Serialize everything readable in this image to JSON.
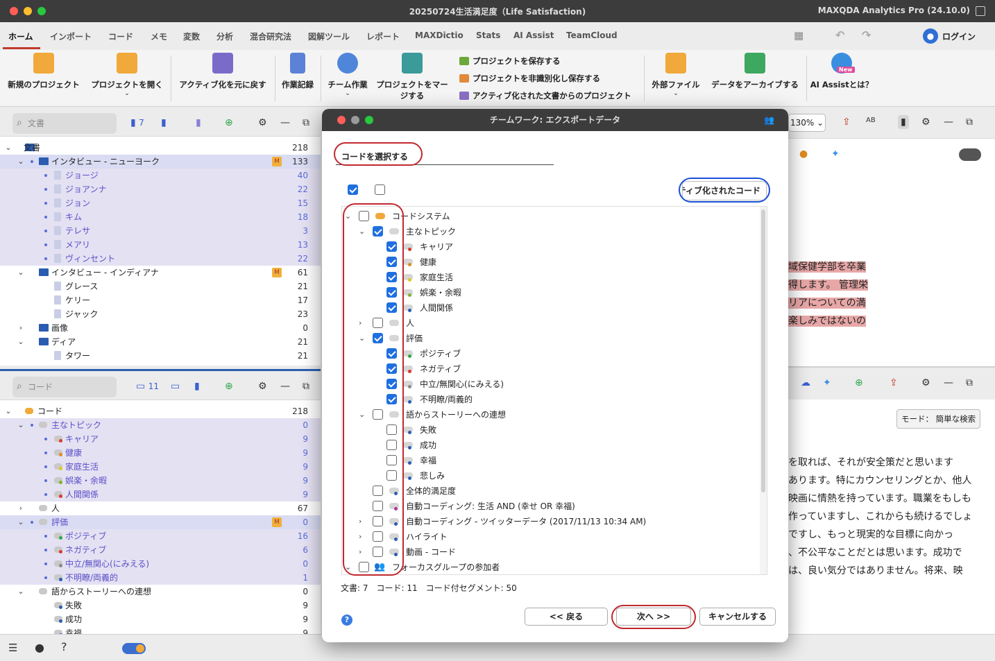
{
  "window": {
    "title": "20250724生活満足度（Life Satisfaction)",
    "app": "MAXQDA Analytics Pro (24.10.0)"
  },
  "menu": {
    "tabs": [
      "ホーム",
      "インポート",
      "コード",
      "メモ",
      "変数",
      "分析",
      "混合研究法",
      "図解ツール",
      "レポート",
      "MAXDictio",
      "Stats",
      "AI Assist",
      "TeamCloud"
    ],
    "login": "ログイン"
  },
  "ribbon": {
    "new_project": "新規のプロジェクト",
    "open_project": "プロジェクトを開く",
    "undo_activation": "アクティブ化を元に戻す",
    "log": "作業記録",
    "teamwork": "チーム作業",
    "merge": "プロジェクトをマージする",
    "save_project": "プロジェクトを保存する",
    "save_anon": "プロジェクトを非識別化し保存する",
    "from_active": "アクティブ化された文書からのプロジェクト",
    "external": "外部ファイル",
    "archive": "データをアーカイブする",
    "ai_assist": "AI Assistとは？",
    "new_badge": "New"
  },
  "doc_panel": {
    "search_placeholder": "文書",
    "count": "7",
    "rows": [
      {
        "label": "文書",
        "num": "218"
      },
      {
        "label": "インタビュー - ニューヨーク",
        "num": "133",
        "badge": "M"
      },
      {
        "label": "ジョージ",
        "num": "40"
      },
      {
        "label": "ジョアンナ",
        "num": "22"
      },
      {
        "label": "ジョン",
        "num": "15"
      },
      {
        "label": "キム",
        "num": "18"
      },
      {
        "label": "テレサ",
        "num": "3"
      },
      {
        "label": "メアリ",
        "num": "13"
      },
      {
        "label": "ヴィンセント",
        "num": "22"
      },
      {
        "label": "インタビュー - インディアナ",
        "num": "61",
        "badge": "M"
      },
      {
        "label": "グレース",
        "num": "21"
      },
      {
        "label": "ケリー",
        "num": "17"
      },
      {
        "label": "ジャック",
        "num": "23"
      },
      {
        "label": "画像",
        "num": "0"
      },
      {
        "label": "ディア",
        "num": "21"
      },
      {
        "label": "タワー",
        "num": "21"
      }
    ]
  },
  "code_panel": {
    "search_placeholder": "コード",
    "count": "11",
    "rows": [
      {
        "label": "コード",
        "num": "218"
      },
      {
        "label": "主なトピック",
        "num": "0"
      },
      {
        "label": "キャリア",
        "num": "9"
      },
      {
        "label": "健康",
        "num": "9"
      },
      {
        "label": "家庭生活",
        "num": "9"
      },
      {
        "label": "娯楽・余暇",
        "num": "9"
      },
      {
        "label": "人間関係",
        "num": "9"
      },
      {
        "label": "人",
        "num": "67"
      },
      {
        "label": "評価",
        "num": "0",
        "badge": "M"
      },
      {
        "label": "ポジティブ",
        "num": "16"
      },
      {
        "label": "ネガティブ",
        "num": "6"
      },
      {
        "label": "中立/無関心(にみえる)",
        "num": "0"
      },
      {
        "label": "不明瞭/両義的",
        "num": "1"
      },
      {
        "label": "語からストーリーへの連想",
        "num": "0"
      },
      {
        "label": "失敗",
        "num": "9"
      },
      {
        "label": "成功",
        "num": "9"
      },
      {
        "label": "幸福",
        "num": "9"
      }
    ]
  },
  "right_panel": {
    "zoom": "130%",
    "upper_text": [
      "域保健学部を卒業",
      "得します。 管理栄",
      "リアについての満",
      "楽しみではないの"
    ],
    "mode_label": "モード： 簡単な検索",
    "lower_text": [
      "を取れば、それが安全策だと思います",
      "あります。特にカウンセリングとか、他人",
      "映画に情熱を持っています。職業をもしも",
      "作っていますし、これからも続けるでしょ",
      "ですし、もっと現実的な目標に向かっ",
      "、不公平なことだとは思います。成功で",
      "は、良い気分ではありません。将来、映"
    ]
  },
  "dialog": {
    "title": "チームワーク: エクスポートデータ",
    "tab": "コードを選択する",
    "active_button": "アクティブ化されたコード",
    "tree": [
      {
        "label": "コードシステム",
        "checked": false,
        "depth": 0,
        "chev": "v"
      },
      {
        "label": "主なトピック",
        "checked": true,
        "depth": 1,
        "chev": "v"
      },
      {
        "label": "キャリア",
        "checked": true,
        "depth": 2,
        "color": "#d93a2b"
      },
      {
        "label": "健康",
        "checked": true,
        "depth": 2,
        "color": "#e08a1e"
      },
      {
        "label": "家庭生活",
        "checked": true,
        "depth": 2,
        "color": "#e0c81e"
      },
      {
        "label": "娯楽・余暇",
        "checked": true,
        "depth": 2,
        "color": "#7bb52a"
      },
      {
        "label": "人間関係",
        "checked": true,
        "depth": 2,
        "color": "#2a5db0"
      },
      {
        "label": "人",
        "checked": false,
        "depth": 1,
        "chev": ">"
      },
      {
        "label": "評価",
        "checked": true,
        "depth": 1,
        "chev": "v"
      },
      {
        "label": "ポジティブ",
        "checked": true,
        "depth": 2,
        "color": "#2fa84a"
      },
      {
        "label": "ネガティブ",
        "checked": true,
        "depth": 2,
        "color": "#d93a2b"
      },
      {
        "label": "中立/無関心(にみえる)",
        "checked": true,
        "depth": 2,
        "color": "#888"
      },
      {
        "label": "不明瞭/両義的",
        "checked": true,
        "depth": 2,
        "color": "#2a5db0"
      },
      {
        "label": "語からストーリーへの連想",
        "checked": false,
        "depth": 1,
        "chev": "v"
      },
      {
        "label": "失敗",
        "checked": false,
        "depth": 2,
        "color": "#2a5db0"
      },
      {
        "label": "成功",
        "checked": false,
        "depth": 2,
        "color": "#2a5db0"
      },
      {
        "label": "幸福",
        "checked": false,
        "depth": 2,
        "color": "#2a5db0"
      },
      {
        "label": "悲しみ",
        "checked": false,
        "depth": 2,
        "color": "#2a5db0"
      },
      {
        "label": "全体的満足度",
        "checked": false,
        "depth": 1,
        "color": "#2a5db0"
      },
      {
        "label": "自動コーディング: 生活 AND (幸せ OR 幸福)",
        "checked": false,
        "depth": 1,
        "color": "#b0329a"
      },
      {
        "label": "自動コーディング - ツイッターデータ (2017/11/13 10:34 AM)",
        "checked": false,
        "depth": 1,
        "chev": ">",
        "color": "#2a5db0"
      },
      {
        "label": "ハイライト",
        "checked": false,
        "depth": 1,
        "chev": ">",
        "color": "#2a5db0"
      },
      {
        "label": "動画 - コード",
        "checked": false,
        "depth": 1,
        "chev": ">",
        "color": "#2a5db0"
      },
      {
        "label": "フォーカスグループの参加者",
        "checked": false,
        "depth": 0,
        "chev": "v",
        "color": "#e0559a"
      }
    ],
    "status": "文書: 7　コード: 11　コード付セグメント: 50",
    "back": "<< 戻る",
    "next": "次へ >>",
    "cancel": "キャンセルする"
  },
  "colors": {
    "accent": "#1f6fe0",
    "highlight_red": "#c0282d",
    "highlight_blue": "#1a4fd6"
  }
}
